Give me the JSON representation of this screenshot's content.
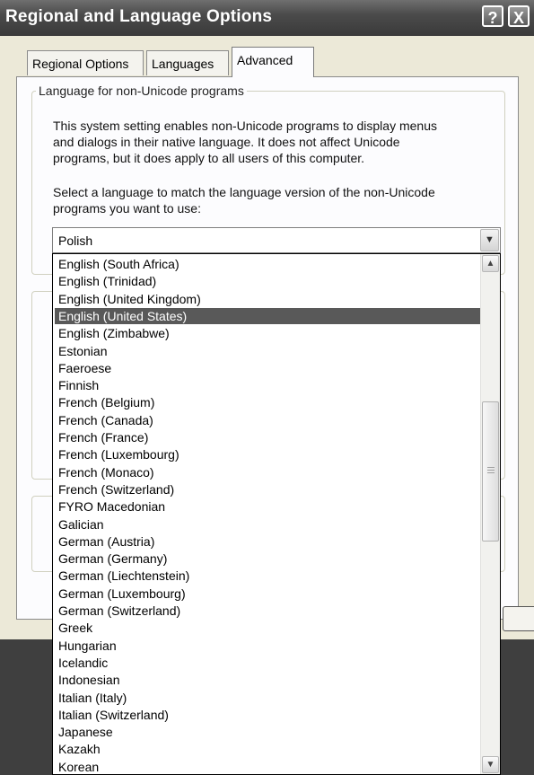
{
  "window": {
    "title": "Regional and Language Options",
    "help_button": "?",
    "close_button": "X"
  },
  "tabs": [
    {
      "label": "Regional Options",
      "active": false
    },
    {
      "label": "Languages",
      "active": false
    },
    {
      "label": "Advanced",
      "active": true
    }
  ],
  "group_nonunicode": {
    "legend": "Language for non-Unicode programs",
    "description_lines": [
      "This system setting enables non-Unicode programs to display menus",
      "and dialogs in their native language. It does not affect Unicode",
      "programs, but it does apply to all users of this computer."
    ],
    "prompt_lines": [
      "Select a language to match the language version of the non-Unicode",
      "programs you want to use:"
    ]
  },
  "language_select": {
    "value": "Polish",
    "arrow_icon": "chevron-down",
    "options": [
      "English (South Africa)",
      "English (Trinidad)",
      "English (United Kingdom)",
      "English (United States)",
      "English (Zimbabwe)",
      "Estonian",
      "Faeroese",
      "Finnish",
      "French (Belgium)",
      "French (Canada)",
      "French (France)",
      "French (Luxembourg)",
      "French (Monaco)",
      "French (Switzerland)",
      "FYRO Macedonian",
      "Galician",
      "German (Austria)",
      "German (Germany)",
      "German (Liechtenstein)",
      "German (Luxembourg)",
      "German (Switzerland)",
      "Greek",
      "Hungarian",
      "Icelandic",
      "Indonesian",
      "Italian (Italy)",
      "Italian (Switzerland)",
      "Japanese",
      "Kazakh",
      "Korean"
    ],
    "highlighted_option": "English (United States)"
  },
  "colors": {
    "title_bar": "#4b4b4b",
    "highlight": "#595959",
    "dialog_bg": "#ece9d8"
  }
}
